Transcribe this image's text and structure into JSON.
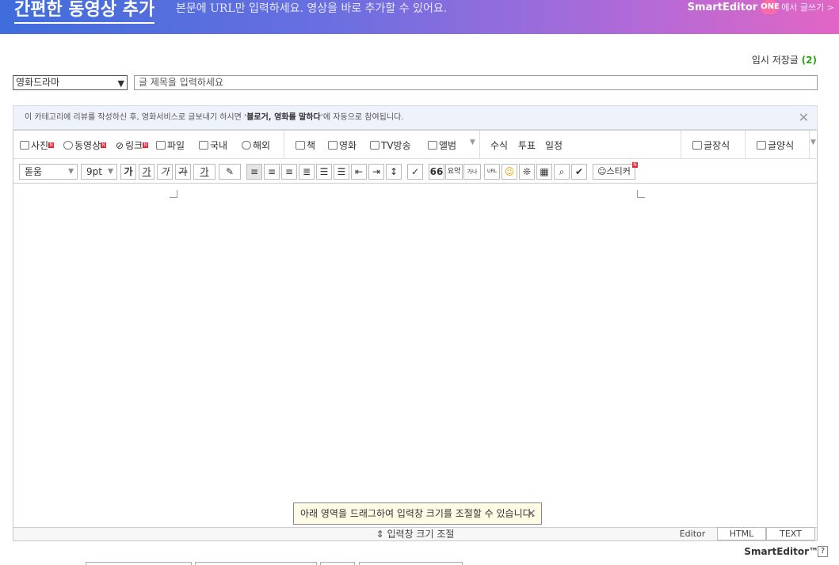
{
  "banner": {
    "title": "간편한 동영상 추가",
    "subtitle": "본문에 URL만 입력하세요. 영상을 바로 추가할 수 있어요.",
    "brand": "SmartEditor",
    "brand_badge": "ONE",
    "brand_link": "에서 글쓰기 >"
  },
  "temp_save": {
    "label": "임시 저장글",
    "count": "(2)"
  },
  "category": {
    "value": "영화드라마"
  },
  "title_field": {
    "placeholder": "글 제목을 입력하세요"
  },
  "notice": {
    "before": "이 카테고리에 리뷰를 작성하신 후, 영화서비스로 글보내기 하시면 ‘",
    "bold": "블로거, 영화를 말하다",
    "after": "’에 자동으로 참여됩니다."
  },
  "toolbar1": {
    "photo": "사진",
    "video": "동영상",
    "link": "링크",
    "file": "파일",
    "domestic": "국내",
    "overseas": "해외",
    "book": "책",
    "movie": "영화",
    "tv": "TV방송",
    "album": "앨범",
    "formula": "수식",
    "vote": "투표",
    "schedule": "일정",
    "text_style": "글장식",
    "template": "글양식"
  },
  "toolbar2": {
    "font": "돋움",
    "size": "9pt",
    "bold": "가",
    "underline": "가",
    "italic": "가",
    "strike": "가",
    "color": "가",
    "quote": "66",
    "summary": "요약",
    "superscript": "가나",
    "url": "URL",
    "sticker": "스티커"
  },
  "tip": {
    "text": "아래 영역을 드래그하여 입력창 크기를 조절할 수 있습니다."
  },
  "resize": {
    "label": "입력창 크기 조절"
  },
  "modes": {
    "editor": "Editor",
    "html": "HTML",
    "text": "TEXT"
  },
  "footer": {
    "brand": "SmartEditor™",
    "help": "?"
  }
}
